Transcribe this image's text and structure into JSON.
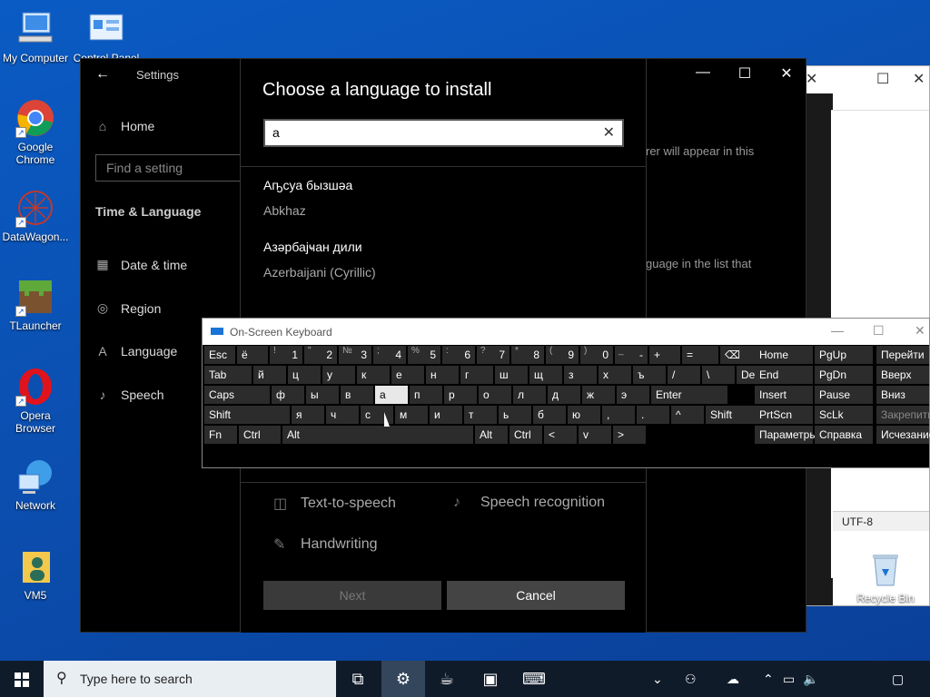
{
  "desktop": {
    "icons": [
      {
        "label": "My Computer",
        "icon": "computer-icon"
      },
      {
        "label": "Control Panel",
        "icon": "control-panel-icon"
      },
      {
        "label": "Google Chrome",
        "icon": "chrome-icon"
      },
      {
        "label": "DataWagon...",
        "icon": "datawagon-icon"
      },
      {
        "label": "TLauncher",
        "icon": "minecraft-block-icon"
      },
      {
        "label": "Opera Browser",
        "icon": "opera-icon"
      },
      {
        "label": "Network",
        "icon": "network-globe-icon"
      },
      {
        "label": "VM5",
        "icon": "user-folder-icon"
      }
    ],
    "recycle_bin": "Recycle Bin"
  },
  "bg_window": {
    "status_encoding": "UTF-8"
  },
  "settings": {
    "title": "Settings",
    "home": "Home",
    "find_placeholder": "Find a setting",
    "section": "Time & Language",
    "nav": [
      {
        "label": "Date & time",
        "icon": "calendar-clock-icon"
      },
      {
        "label": "Region",
        "icon": "globe-icon"
      },
      {
        "label": "Language",
        "icon": "language-icon"
      },
      {
        "label": "Speech",
        "icon": "microphone-icon"
      }
    ],
    "bg_text_1": "rer will appear in this",
    "bg_text_2": "guage in the list that"
  },
  "dialog": {
    "title": "Choose a language to install",
    "search_value": "a",
    "languages": [
      {
        "native": "Аҧсуа бызшәа",
        "english": "Abkhaz"
      },
      {
        "native": "Азәрбајҹан дили",
        "english": "Azerbaijani (Cyrillic)"
      }
    ],
    "features": [
      {
        "label": "Text-to-speech",
        "icon": "text-to-speech-icon"
      },
      {
        "label": "Speech recognition",
        "icon": "microphone-icon"
      },
      {
        "label": "Handwriting",
        "icon": "pen-icon"
      }
    ],
    "next": "Next",
    "cancel": "Cancel"
  },
  "osk": {
    "title": "On-Screen Keyboard",
    "rows": [
      [
        "Esc",
        "ё",
        "!",
        "1",
        "\"",
        "2",
        "№",
        "3",
        ";",
        "4",
        "%",
        "5",
        ":",
        "6",
        "?",
        "7",
        "*",
        "8",
        "(",
        "9",
        ")",
        "0",
        "_",
        "-",
        "+",
        "=",
        "⌫"
      ],
      [
        "Tab",
        "й",
        "ц",
        "у",
        "к",
        "е",
        "н",
        "г",
        "ш",
        "щ",
        "з",
        "х",
        "ъ",
        "/",
        "\\",
        "Del"
      ],
      [
        "Caps",
        "ф",
        "ы",
        "в",
        "а",
        "п",
        "р",
        "о",
        "л",
        "д",
        "ж",
        "э",
        "Enter"
      ],
      [
        "Shift",
        "я",
        "ч",
        "с",
        "м",
        "и",
        "т",
        "ь",
        "б",
        "ю",
        ",",
        ".",
        "^",
        "Shift"
      ],
      [
        "Fn",
        "Ctrl",
        "Alt",
        "Alt",
        "Ctrl",
        "<",
        "v",
        ">"
      ]
    ],
    "nav_keys": [
      "Home",
      "PgUp",
      "Перейти",
      "End",
      "PgDn",
      "Вверх",
      "Insert",
      "Pause",
      "Вниз",
      "PrtScn",
      "ScLk",
      "Закрепить",
      "Параметры",
      "Справка",
      "Исчезание"
    ]
  },
  "taskbar": {
    "search_placeholder": "Type here to search"
  }
}
